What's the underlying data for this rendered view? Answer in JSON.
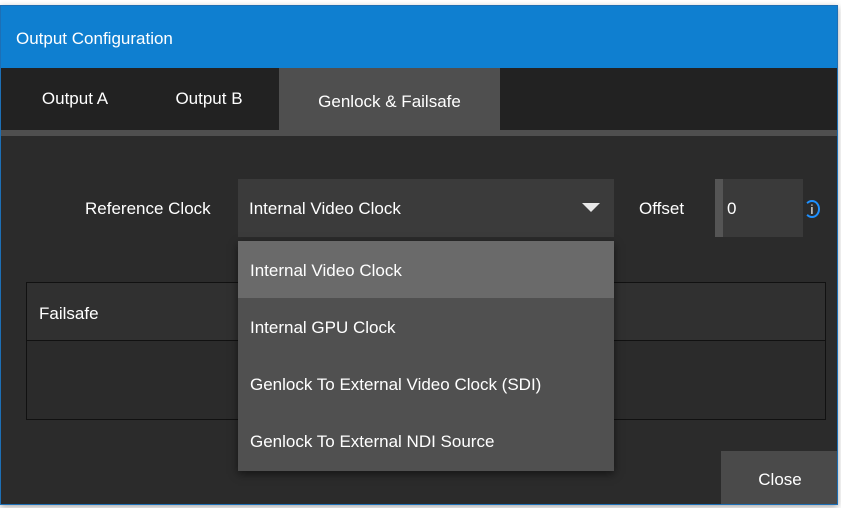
{
  "window": {
    "title": "Output Configuration"
  },
  "tabs": [
    {
      "label": "Output A"
    },
    {
      "label": "Output B"
    },
    {
      "label": "Genlock & Failsafe",
      "active": true
    }
  ],
  "reference_clock": {
    "label": "Reference Clock",
    "selected": "Internal Video Clock",
    "options": [
      "Internal Video Clock",
      "Internal GPU Clock",
      "Genlock To External Video Clock (SDI)",
      "Genlock To External NDI Source"
    ]
  },
  "offset": {
    "label": "Offset",
    "value": "0",
    "info_glyph": "i"
  },
  "failsafe": {
    "title": "Failsafe"
  },
  "buttons": {
    "close": "Close"
  },
  "colors": {
    "titlebar": "#0f7fd0",
    "background": "#2b2b2b",
    "accent": "#1e90ff"
  }
}
